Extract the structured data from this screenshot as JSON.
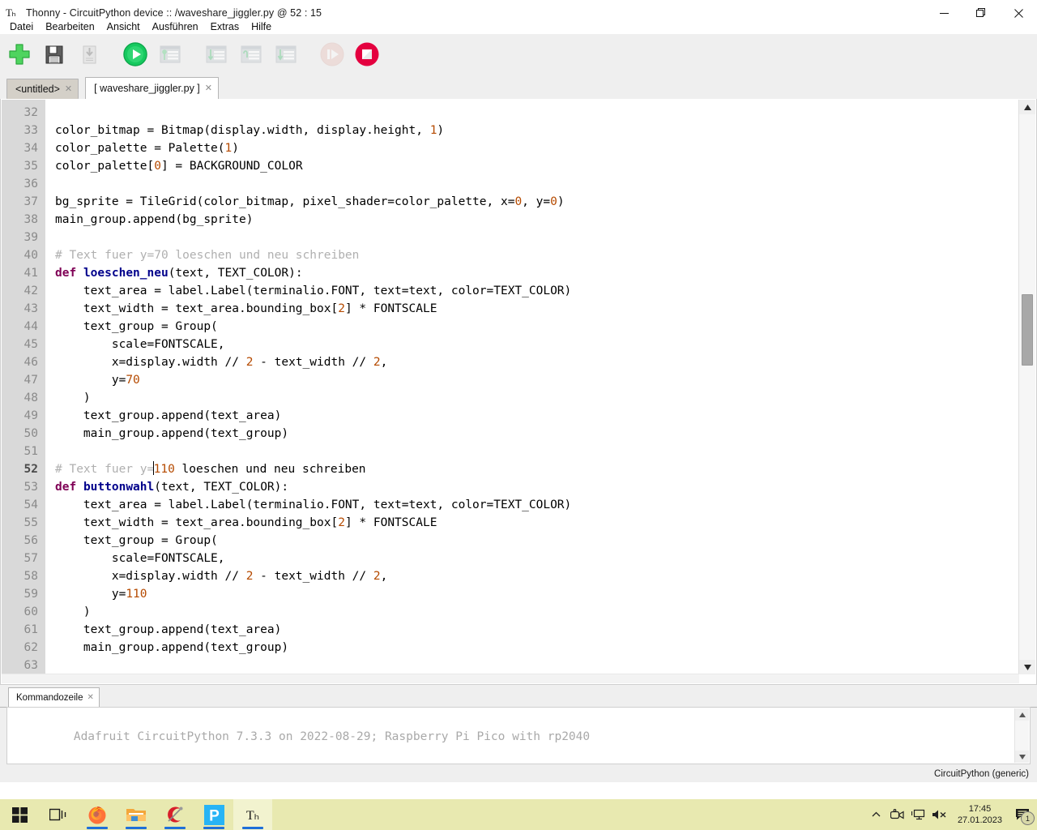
{
  "window": {
    "title": "Thonny  -  CircuitPython device :: /waveshare_jiggler.py  @  52 : 15",
    "icon": "thonny-icon",
    "minimize": "–",
    "maximize": "❐",
    "close": "✕"
  },
  "menu": {
    "items": [
      {
        "label": "Datei",
        "name": "menu-datei"
      },
      {
        "label": "Bearbeiten",
        "name": "menu-bearbeiten"
      },
      {
        "label": "Ansicht",
        "name": "menu-ansicht"
      },
      {
        "label": "Ausführen",
        "name": "menu-ausfuehren"
      },
      {
        "label": "Extras",
        "name": "menu-extras"
      },
      {
        "label": "Hilfe",
        "name": "menu-hilfe"
      }
    ]
  },
  "toolbar": {
    "buttons": [
      {
        "name": "new-file-button",
        "icon": "plus-icon",
        "enabled": true
      },
      {
        "name": "save-button",
        "icon": "save-floppy-icon",
        "enabled": true
      },
      {
        "name": "load-button",
        "icon": "load-file-icon",
        "enabled": false
      },
      {
        "name": "run-button",
        "icon": "play-icon",
        "enabled": true
      },
      {
        "name": "debug-button",
        "icon": "debug-icon",
        "enabled": false
      },
      {
        "name": "step-into-button",
        "icon": "step-into-icon",
        "enabled": false
      },
      {
        "name": "step-over-button",
        "icon": "step-over-icon",
        "enabled": false
      },
      {
        "name": "step-out-button",
        "icon": "step-out-icon",
        "enabled": false
      },
      {
        "name": "resume-button",
        "icon": "resume-icon",
        "enabled": false
      },
      {
        "name": "stop-button",
        "icon": "stop-icon",
        "enabled": true
      }
    ]
  },
  "editor_tabs": [
    {
      "label": "<untitled>",
      "active": false,
      "close": "✕",
      "name": "tab-untitled"
    },
    {
      "label": "[ waveshare_jiggler.py ]",
      "active": true,
      "close": "✕",
      "name": "tab-waveshare-jiggler"
    }
  ],
  "editor": {
    "first_line": 32,
    "current_line": 52,
    "cursor": "52 : 15",
    "line_numbers": [
      32,
      33,
      34,
      35,
      36,
      37,
      38,
      39,
      40,
      41,
      42,
      43,
      44,
      45,
      46,
      47,
      48,
      49,
      50,
      51,
      52,
      53,
      54,
      55,
      56,
      57,
      58,
      59,
      60,
      61,
      62,
      63
    ],
    "lines": [
      "",
      "color_bitmap = Bitmap(display.width, display.height, 1)",
      "color_palette = Palette(1)",
      "color_palette[0] = BACKGROUND_COLOR",
      "",
      "bg_sprite = TileGrid(color_bitmap, pixel_shader=color_palette, x=0, y=0)",
      "main_group.append(bg_sprite)",
      "",
      "# Text fuer y=70 loeschen und neu schreiben",
      "def loeschen_neu(text, TEXT_COLOR):",
      "    text_area = label.Label(terminalio.FONT, text=text, color=TEXT_COLOR)",
      "    text_width = text_area.bounding_box[2] * FONTSCALE",
      "    text_group = Group(",
      "        scale=FONTSCALE,",
      "        x=display.width // 2 - text_width // 2,",
      "        y=70",
      "    )",
      "    text_group.append(text_area)",
      "    main_group.append(text_group)",
      "",
      "# Text fuer y=110 loeschen und neu schreiben",
      "def buttonwahl(text, TEXT_COLOR):",
      "    text_area = label.Label(terminalio.FONT, text=text, color=TEXT_COLOR)",
      "    text_width = text_area.bounding_box[2] * FONTSCALE",
      "    text_group = Group(",
      "        scale=FONTSCALE,",
      "        x=display.width // 2 - text_width // 2,",
      "        y=110",
      "    )",
      "    text_group.append(text_area)",
      "    main_group.append(text_group)",
      ""
    ]
  },
  "shell": {
    "tab_label": "Kommandozeile",
    "tab_close": "✕",
    "banner": "Adafruit CircuitPython 7.3.3 on 2022-08-29; Raspberry Pi Pico with rp2040",
    "prompt": ">>>"
  },
  "status": {
    "interpreter": "CircuitPython (generic)"
  },
  "taskbar": {
    "items": [
      {
        "name": "start-button",
        "icon": "windows-logo-icon",
        "running": false,
        "active": false
      },
      {
        "name": "task-view-button",
        "icon": "task-view-icon",
        "running": false,
        "active": false
      },
      {
        "name": "taskbar-firefox",
        "icon": "firefox-icon",
        "running": true,
        "active": false
      },
      {
        "name": "taskbar-explorer",
        "icon": "folder-icon",
        "running": true,
        "active": false
      },
      {
        "name": "taskbar-chrome-c",
        "icon": "c-app-icon",
        "running": true,
        "active": false
      },
      {
        "name": "taskbar-p-app",
        "icon": "p-app-icon",
        "running": true,
        "active": false
      },
      {
        "name": "taskbar-thonny",
        "icon": "thonny-icon",
        "running": true,
        "active": true
      }
    ],
    "tray": {
      "chevron": "⌃",
      "icons": [
        "camera-icon",
        "network-icon",
        "volume-muted-icon"
      ],
      "time": "17:45",
      "date": "27.01.2023",
      "notification_count": "1"
    }
  },
  "colors": {
    "accent_green": "#2ecc62",
    "stop_red": "#e0003c",
    "keyword": "#7f0055",
    "function": "#00008b",
    "number": "#b54a00",
    "comment": "#b0b0b0",
    "taskbar_bg": "#e8e9b0"
  }
}
